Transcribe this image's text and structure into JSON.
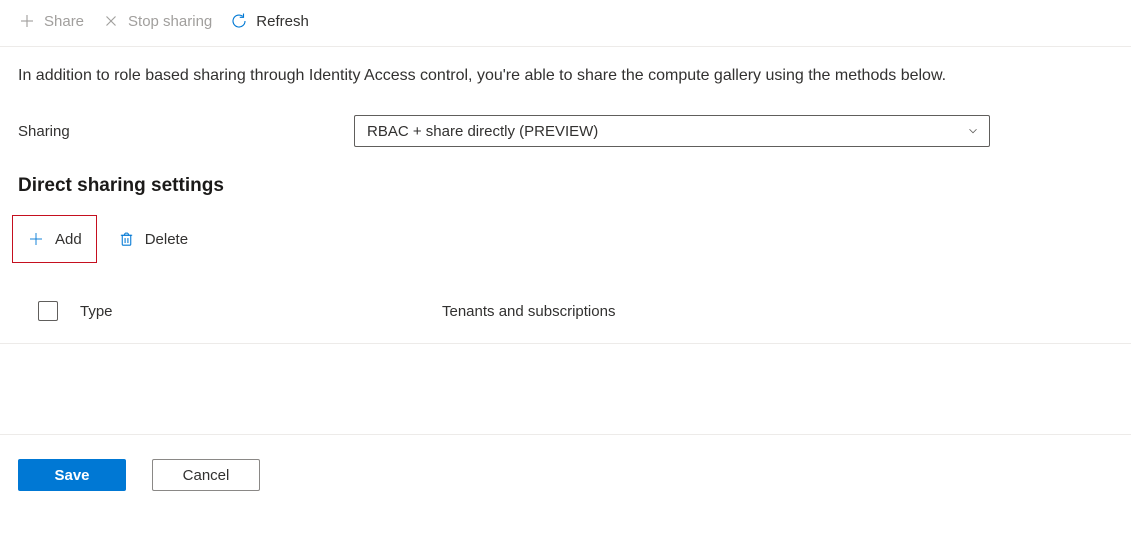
{
  "toolbar": {
    "share_label": "Share",
    "stop_sharing_label": "Stop sharing",
    "refresh_label": "Refresh"
  },
  "description": "In addition to role based sharing through Identity Access control, you're able to share the compute gallery using the methods below.",
  "form": {
    "sharing_label": "Sharing",
    "sharing_value": "RBAC + share directly (PREVIEW)"
  },
  "section_heading": "Direct sharing settings",
  "actions": {
    "add_label": "Add",
    "delete_label": "Delete"
  },
  "table": {
    "col_type": "Type",
    "col_tenants": "Tenants and subscriptions"
  },
  "footer": {
    "save_label": "Save",
    "cancel_label": "Cancel"
  }
}
